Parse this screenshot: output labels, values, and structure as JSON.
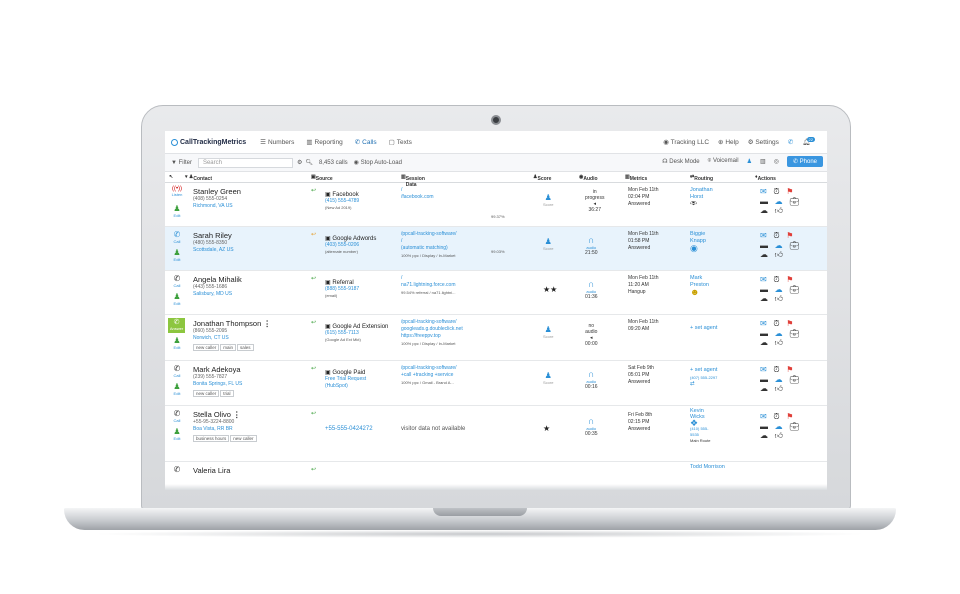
{
  "app": {
    "logo_text": "CallTrackingMetrics",
    "nav": [
      "Numbers",
      "Reporting",
      "Calls",
      "Texts"
    ],
    "right_nav": [
      "Tracking LLC",
      "Help",
      "Settings"
    ],
    "notification_count": "22"
  },
  "filter": {
    "label": "Filter",
    "search_placeholder": "Search",
    "calls_count": "8,453 calls",
    "stop_label": "Stop Auto-Load",
    "desk_mode": "Desk Mode",
    "voicemail": "Voicemail",
    "phone": "Phone"
  },
  "columns": [
    "Contact",
    "Source",
    "Session Data",
    "Score",
    "Audio",
    "Metrics",
    "Routing",
    "Actions"
  ],
  "rows": [
    {
      "status": "Listen",
      "edit": "Edit",
      "name": "Stanley Green",
      "phone": "(408) 555-0254",
      "location": "Richmond, VA US",
      "tags": [],
      "source": "Facebook",
      "source_number": "(415) 555-4789",
      "source_note": "(New Ad 2019)",
      "session": [
        "/",
        "/facebook.com",
        ""
      ],
      "session_pct": "99.37%",
      "score": "Score",
      "audio": [
        "in",
        "progress",
        "36:27"
      ],
      "metrics": [
        "Mon Feb 11th",
        "02:04 PM",
        "Answered"
      ],
      "routing": [
        "Jonathan",
        "Horst"
      ]
    },
    {
      "status": "Call",
      "edit": "Edit",
      "name": "Sarah Riley",
      "phone": "(480) 555-8350",
      "location": "Scottsdale, AZ US",
      "tags": [],
      "source": "Google Adwords",
      "source_number": "(403) 555-0206",
      "source_note": "(alternate number)",
      "session": [
        "/ppcall-tracking-software/",
        "/",
        "(automatic matching)",
        "100% ppc / Display / In-Market"
      ],
      "session_pct": "99.03%",
      "score": "Score",
      "audio": [
        "audio",
        "21:50"
      ],
      "metrics": [
        "Mon Feb 11th",
        "01:58 PM",
        "Answered"
      ],
      "routing": [
        "Biggie",
        "Knapp"
      ]
    },
    {
      "status": "Call",
      "edit": "Edit",
      "name": "Angela Mihalik",
      "phone": "(443) 555-1686",
      "location": "Salisbury, MD US",
      "tags": [],
      "source": "Referral",
      "source_number": "(888) 555-9187",
      "source_note": "(email)",
      "session": [
        "/",
        "na71.lightning.force.com",
        "",
        "99.54% referral / na71.lightni..."
      ],
      "session_pct": "",
      "score": "★★",
      "audio": [
        "audio",
        "01:36"
      ],
      "metrics": [
        "Mon Feb 11th",
        "11:20 AM",
        "Hangup"
      ],
      "routing": [
        "Mark",
        "Preston"
      ]
    },
    {
      "status": "Answer",
      "edit": "Edit",
      "name": "Jonathan Thompson",
      "phone": "(860) 555-2095",
      "location": "Norwich, CT US",
      "tags": [
        "new caller",
        "main",
        "sales"
      ],
      "source": "Google Ad Extension",
      "source_number": "(615) 555-7113",
      "source_note": "(Google Ad Ext Mkt)",
      "session": [
        "/ppcall-tracking-software/",
        "googleads.g.doubleclick.net",
        "https://freeppv.top",
        "100% ppc / Display / In-Market"
      ],
      "session_pct": "",
      "score": "Score",
      "audio": [
        "no",
        "audio",
        "00:00"
      ],
      "metrics": [
        "Mon Feb 11th",
        "09:20 AM",
        ""
      ],
      "routing": [
        "+ set agent"
      ]
    },
    {
      "status": "Call",
      "edit": "Edit",
      "name": "Mark Adekoya",
      "phone": "(239) 555-7827",
      "location": "Bonita Springs, FL US",
      "tags": [
        "new caller",
        "trial"
      ],
      "source": "Google Paid",
      "source_number": "Free Trial Request",
      "source_note": "(HubSpot)",
      "session": [
        "/ppcall-tracking-software/",
        "",
        "+call +tracking +service",
        "100% ppc / Gmail - Brand A..."
      ],
      "session_pct": "",
      "score": "Score",
      "audio": [
        "audio",
        "00:16"
      ],
      "metrics": [
        "Sat Feb 9th",
        "05:01 PM",
        "Answered"
      ],
      "routing": [
        "+ set agent",
        "(407) 555-2297"
      ]
    },
    {
      "status": "Call",
      "edit": "Edit",
      "name": "Stella Olivo",
      "phone": "+55-95-3224-8800",
      "location": "Boa Vista, RR BR",
      "tags": [
        "business hours",
        "new caller"
      ],
      "source": "",
      "source_number": "+55-555-0424272",
      "source_note": "",
      "session": [
        "visitor data not available"
      ],
      "session_pct": "",
      "score": "★",
      "audio": [
        "audio",
        "00:35"
      ],
      "metrics": [
        "Fri Feb 8th",
        "02:15 PM",
        "Answered"
      ],
      "routing": [
        "Kevin",
        "Wicks",
        "(410) 555-",
        "5535",
        "Main Route"
      ]
    },
    {
      "status": "",
      "edit": "",
      "name": "Valeria Lira",
      "phone": "",
      "location": "",
      "tags": [],
      "source": "",
      "source_number": "",
      "source_note": "",
      "session": [],
      "session_pct": "",
      "score": "",
      "audio": [],
      "metrics": [],
      "routing": [
        "Todd Morrison"
      ]
    }
  ]
}
